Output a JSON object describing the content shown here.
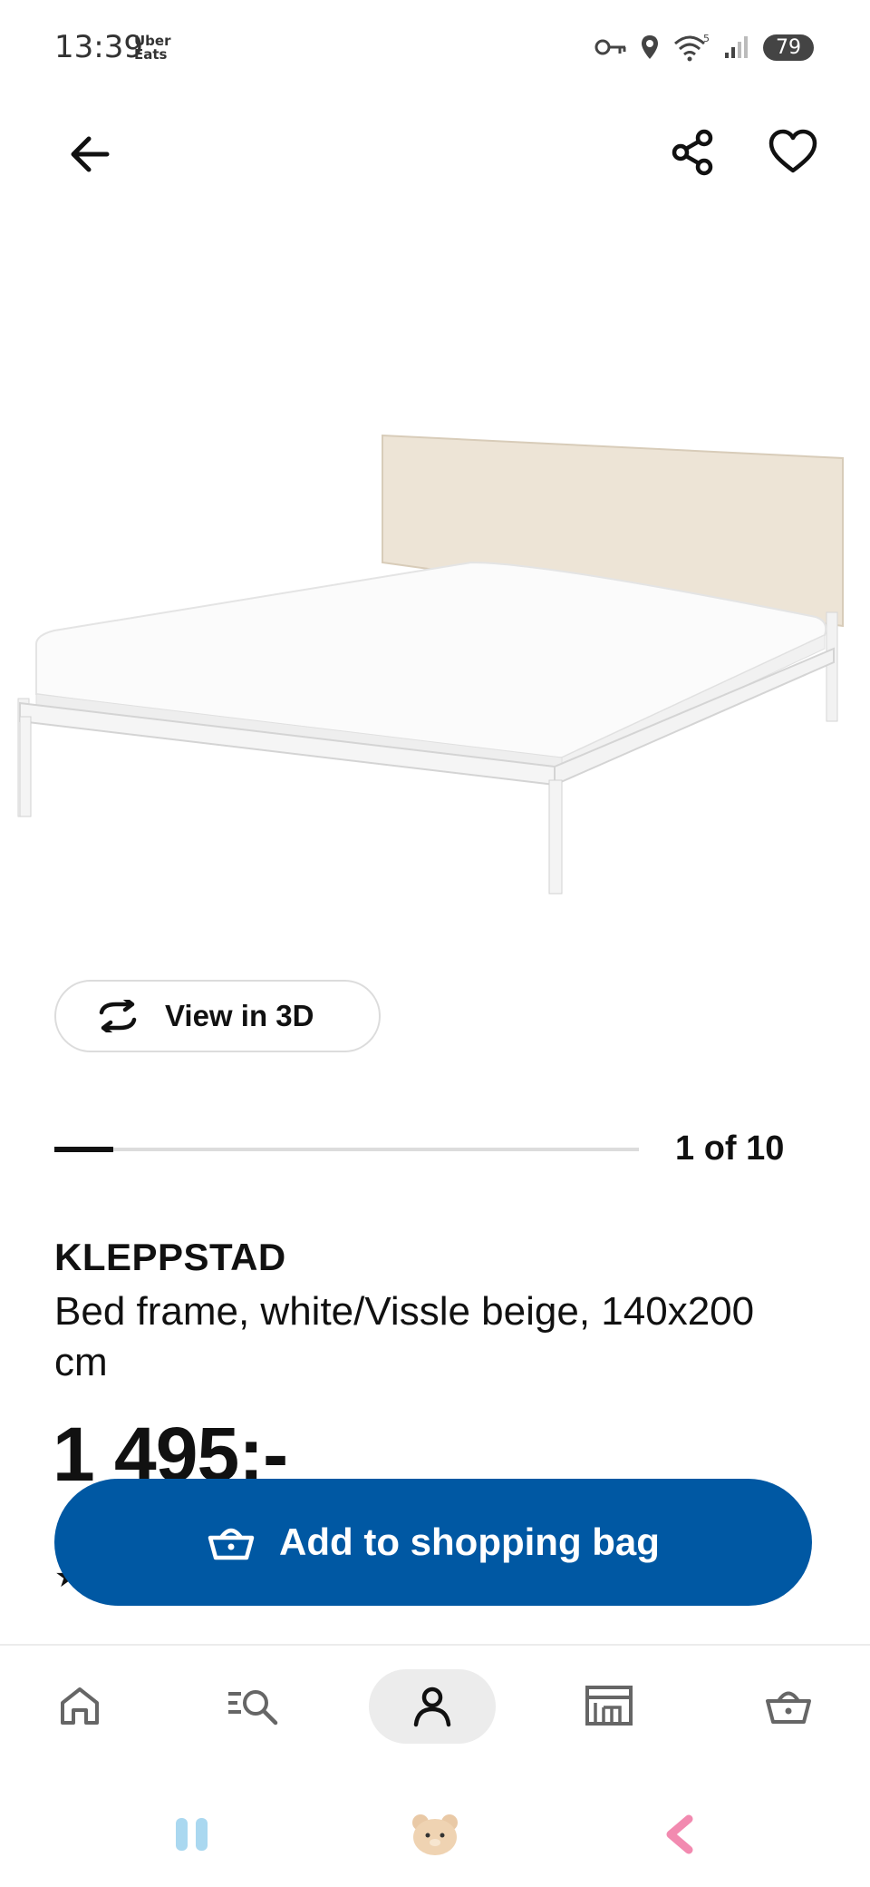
{
  "status_bar": {
    "time": "13:39",
    "app_badge": "Uber\nEats",
    "battery": "79"
  },
  "top_nav": {
    "back_icon": "arrow-left-icon",
    "share_icon": "share-icon",
    "favorite_icon": "heart-icon"
  },
  "gallery": {
    "view_3d_label": "View in 3D",
    "counter": "1 of 10",
    "progress_fraction": 0.1
  },
  "product": {
    "name": "KLEPPSTAD",
    "description": "Bed frame, white/Vissle beige, 140x200 cm",
    "price": "1 495:-"
  },
  "actions": {
    "add_to_bag_label": "Add to shopping bag",
    "accent_color": "#0058a3"
  },
  "bottom_nav": {
    "items": [
      "home-icon",
      "search-icon",
      "profile-icon",
      "store-icon",
      "basket-icon"
    ],
    "active": "profile-icon"
  }
}
